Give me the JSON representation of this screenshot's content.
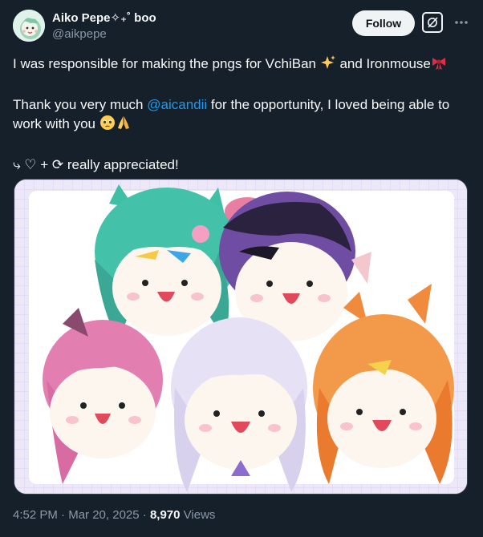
{
  "author": {
    "display_name": "Aiko Pepe✧₊˚ boo",
    "handle": "@aikpepe"
  },
  "actions": {
    "follow_label": "Follow"
  },
  "tweet": {
    "line1_text": "I was responsible for making the pngs for VchiBan",
    "line1_mid": " and Ironmouse",
    "line2_prefix": "Thank you very much ",
    "mention": "@aicandii",
    "line2_suffix": " for the opportunity, I loved being able to",
    "line3_text": "work with you",
    "line4_text": "⤷ ♡ + ⟳ really appreciated!"
  },
  "meta": {
    "time": "4:52 PM",
    "separator1": " · ",
    "date": "Mar 20, 2025",
    "separator2": " · ",
    "views_count": "8,970",
    "views_label": " Views"
  },
  "icons": {
    "sparkles": "sparkles-emoji",
    "ribbon": "ribbon-emoji",
    "pleading_face": "pleading-face-emoji",
    "folded_hands": "folded-hands-emoji",
    "grok": "grok-icon",
    "more": "more-icon"
  },
  "colors": {
    "background": "#15202b",
    "link": "#1d9bf0",
    "muted": "#8b98a5",
    "text": "#f7f9f9",
    "follow_bg": "#eff3f4"
  }
}
